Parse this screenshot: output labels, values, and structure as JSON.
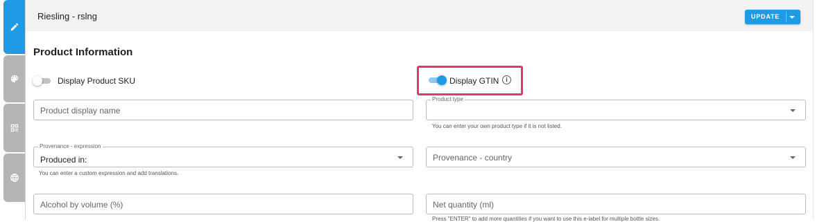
{
  "sidebar": {
    "tabs": [
      {
        "icon": "pencil-icon",
        "active": true
      },
      {
        "icon": "palette-icon",
        "active": false
      },
      {
        "icon": "qr-code-icon",
        "active": false
      },
      {
        "icon": "globe-icon",
        "active": false
      }
    ]
  },
  "header": {
    "title": "Riesling - rslng",
    "update_label": "UPDATE"
  },
  "section": {
    "title": "Product Information"
  },
  "toggles": {
    "sku": {
      "label": "Display Product SKU",
      "checked": false
    },
    "gtin": {
      "label": "Display GTIN",
      "checked": true
    }
  },
  "fields": {
    "display_name": {
      "placeholder": "Product display name",
      "value": ""
    },
    "product_type": {
      "label": "Product type",
      "value": "",
      "hint": "You can enter your own product type if it is not listed."
    },
    "provenance_expression": {
      "label": "Provenance - expression",
      "value": "Produced in:",
      "hint": "You can enter a custom expression and add translations."
    },
    "provenance_country": {
      "placeholder": "Provenance - country",
      "value": ""
    },
    "alcohol": {
      "placeholder": "Alcohol by volume (%)",
      "value": ""
    },
    "net_quantity": {
      "placeholder": "Net quantity (ml)",
      "value": "",
      "hint": "Press \"ENTER\" to add more quantities if you want to use this e-label for multiple bottle sizes."
    }
  },
  "colors": {
    "accent": "#1e9be4",
    "highlight": "#e3376a",
    "sidebar_inactive": "#b5b5b5",
    "header_bg": "#f2f2f2"
  }
}
